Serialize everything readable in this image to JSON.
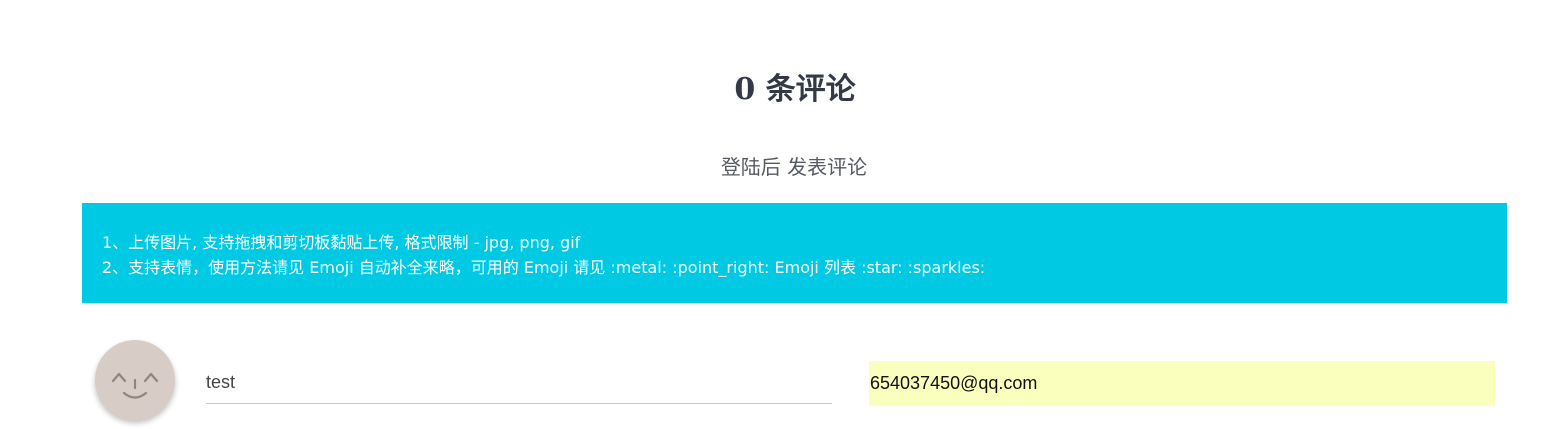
{
  "comments": {
    "title": "0 条评论",
    "login_hint": "登陆后 发表评论"
  },
  "tips": {
    "background_color": "#00c9e3",
    "line1_prefix": "1、上传图片, 支持拖拽和剪切板黏贴上传, 格式限制 - ",
    "line1_formats": "jpg, png, gif",
    "line2_part1": "2、支持表情，使用方法请见 ",
    "line2_emoji1": "Emoji",
    "line2_part2": " 自动补全来略，可用的 ",
    "line2_emoji2": "Emoji",
    "line2_part3": " 请见 ",
    "line2_codes1": ":metal: :point_right: Emoji",
    "line2_part4": " 列表 ",
    "line2_codes2": ":star: :sparkles:"
  },
  "form": {
    "avatar_icon": "smiley-face-icon",
    "name_value": "test",
    "email_value": "654037450@qq.com",
    "email_autofill_color": "#faffbd"
  }
}
